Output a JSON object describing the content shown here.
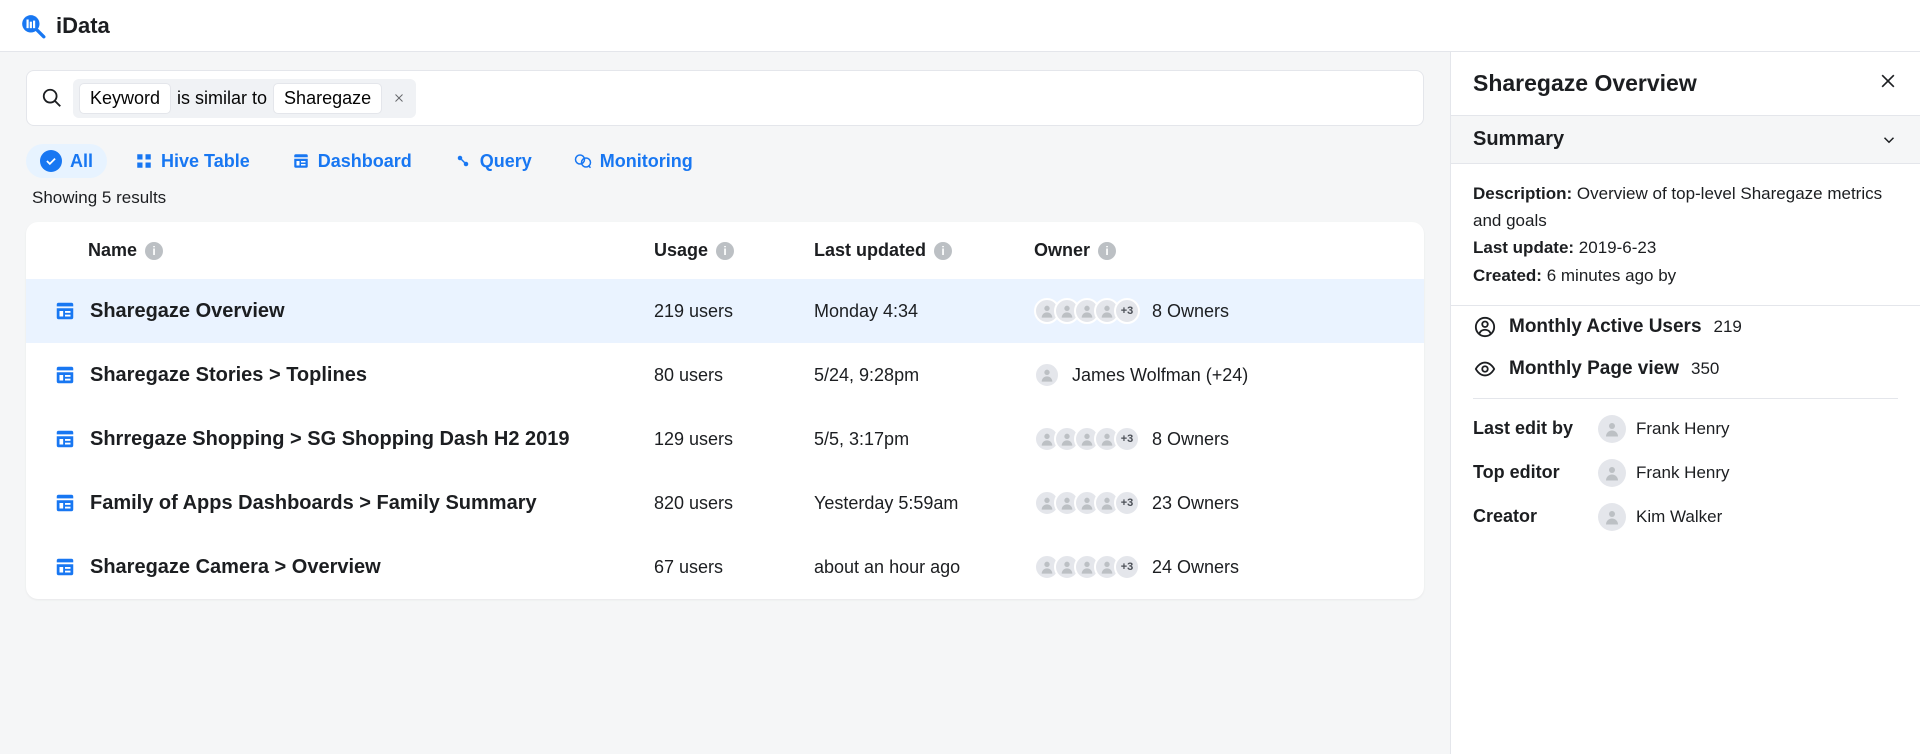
{
  "brand": "iData",
  "search": {
    "field": "Keyword",
    "op": "is similar to",
    "value": "Sharegaze"
  },
  "filters": [
    {
      "label": "All",
      "active": true,
      "icon": "check"
    },
    {
      "label": "Hive Table",
      "active": false,
      "icon": "grid"
    },
    {
      "label": "Dashboard",
      "active": false,
      "icon": "dashboard"
    },
    {
      "label": "Query",
      "active": false,
      "icon": "query"
    },
    {
      "label": "Monitoring",
      "active": false,
      "icon": "monitor"
    }
  ],
  "resultCount": "Showing 5 results",
  "columns": {
    "name": "Name",
    "usage": "Usage",
    "updated": "Last updated",
    "owner": "Owner"
  },
  "rows": [
    {
      "name": "Sharegaze Overview",
      "usage": "219 users",
      "updated": "Monday 4:34",
      "owner_text": "8 Owners",
      "owner_av": 4,
      "owner_more": "+3",
      "selected": true
    },
    {
      "name": "Sharegaze Stories > Toplines",
      "usage": "80 users",
      "updated": "5/24, 9:28pm",
      "owner_text": "James Wolfman (+24)",
      "owner_av": 1,
      "owner_more": "",
      "selected": false
    },
    {
      "name": "Shrregaze Shopping > SG Shopping Dash H2 2019",
      "usage": "129 users",
      "updated": "5/5, 3:17pm",
      "owner_text": "8 Owners",
      "owner_av": 4,
      "owner_more": "+3",
      "selected": false
    },
    {
      "name": "Family of Apps Dashboards > Family Summary",
      "usage": "820 users",
      "updated": "Yesterday 5:59am",
      "owner_text": "23 Owners",
      "owner_av": 4,
      "owner_more": "+3",
      "selected": false
    },
    {
      "name": "Sharegaze Camera > Overview",
      "usage": "67 users",
      "updated": "about an hour ago",
      "owner_text": "24 Owners",
      "owner_av": 4,
      "owner_more": "+3",
      "selected": false
    }
  ],
  "panel": {
    "title": "Sharegaze Overview",
    "section": "Summary",
    "desc_label": "Description:",
    "desc": "Overview of top-level Sharegaze metrics and goals",
    "lastupdate_label": "Last update:",
    "lastupdate": "2019-6-23",
    "created_label": "Created:",
    "created": "6 minutes ago by",
    "stats": [
      {
        "icon": "user",
        "name": "Monthly Active Users",
        "value": "219"
      },
      {
        "icon": "eye",
        "name": "Monthly Page view",
        "value": "350"
      }
    ],
    "people": [
      {
        "label": "Last edit by",
        "name": "Frank Henry"
      },
      {
        "label": "Top editor",
        "name": "Frank Henry"
      },
      {
        "label": "Creator",
        "name": "Kim Walker"
      }
    ]
  }
}
